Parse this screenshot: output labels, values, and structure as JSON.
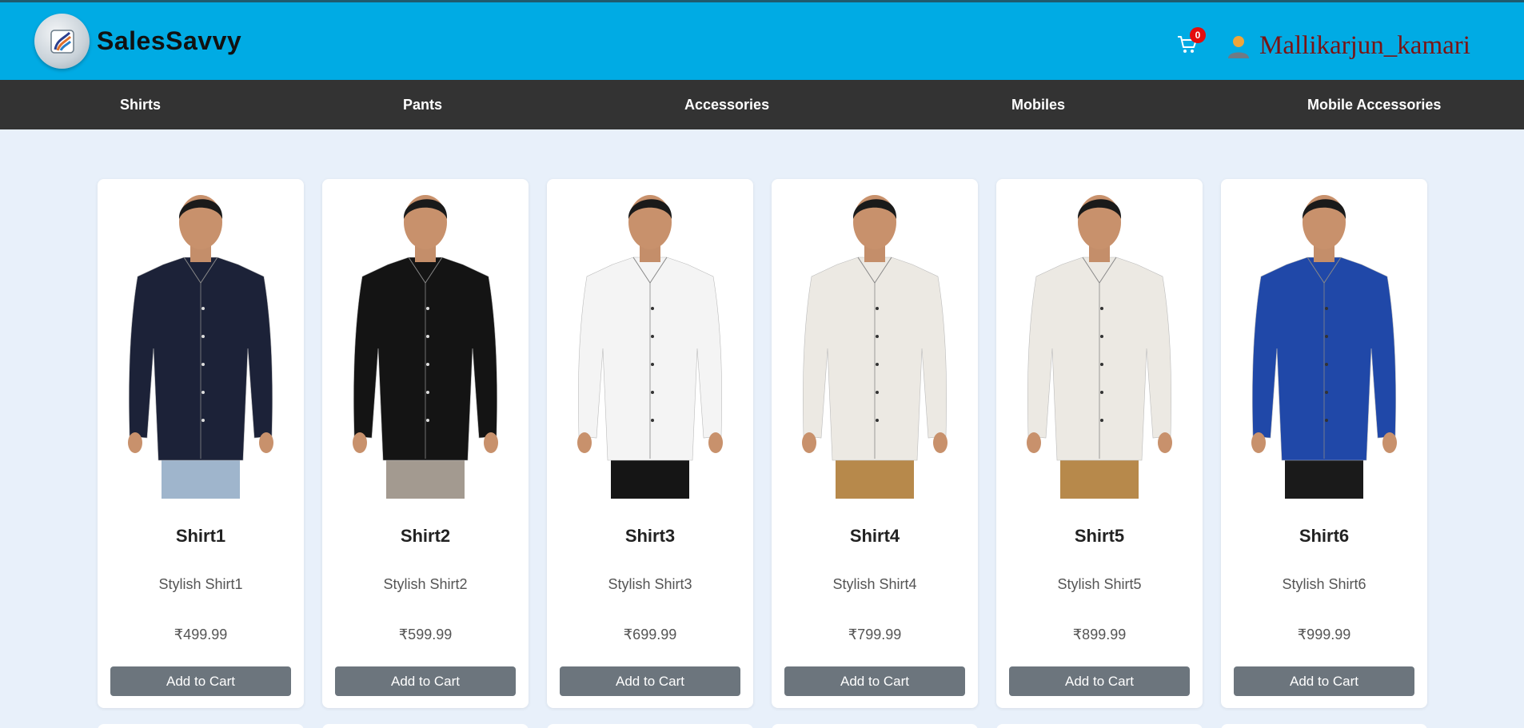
{
  "header": {
    "brand": "SalesSavvy",
    "cart_count": "0",
    "username": "Mallikarjun_kamari"
  },
  "nav": {
    "items": [
      {
        "label": "Shirts"
      },
      {
        "label": "Pants"
      },
      {
        "label": "Accessories"
      },
      {
        "label": "Mobiles"
      },
      {
        "label": "Mobile Accessories"
      }
    ]
  },
  "products": [
    {
      "name": "Shirt1",
      "desc": "Stylish Shirt1",
      "price": "₹499.99",
      "button": "Add to Cart",
      "shirt_color": "#1c2238",
      "pants_color": "#9fb5cc"
    },
    {
      "name": "Shirt2",
      "desc": "Stylish Shirt2",
      "price": "₹599.99",
      "button": "Add to Cart",
      "shirt_color": "#141414",
      "pants_color": "#a39a90"
    },
    {
      "name": "Shirt3",
      "desc": "Stylish Shirt3",
      "price": "₹699.99",
      "button": "Add to Cart",
      "shirt_color": "#f4f4f4",
      "pants_color": "#151515"
    },
    {
      "name": "Shirt4",
      "desc": "Stylish Shirt4",
      "price": "₹799.99",
      "button": "Add to Cart",
      "shirt_color": "#ece9e3",
      "pants_color": "#b7894b"
    },
    {
      "name": "Shirt5",
      "desc": "Stylish Shirt5",
      "price": "₹899.99",
      "button": "Add to Cart",
      "shirt_color": "#ece9e3",
      "pants_color": "#b7894b"
    },
    {
      "name": "Shirt6",
      "desc": "Stylish Shirt6",
      "price": "₹999.99",
      "button": "Add to Cart",
      "shirt_color": "#2048a8",
      "pants_color": "#1a1a1a"
    }
  ],
  "colors": {
    "header_bg": "#00abe4",
    "nav_bg": "#333333",
    "page_bg": "#e8f0fa",
    "button_bg": "#6c757d",
    "badge_bg": "#e40d0d",
    "username_color": "#7a1414"
  }
}
